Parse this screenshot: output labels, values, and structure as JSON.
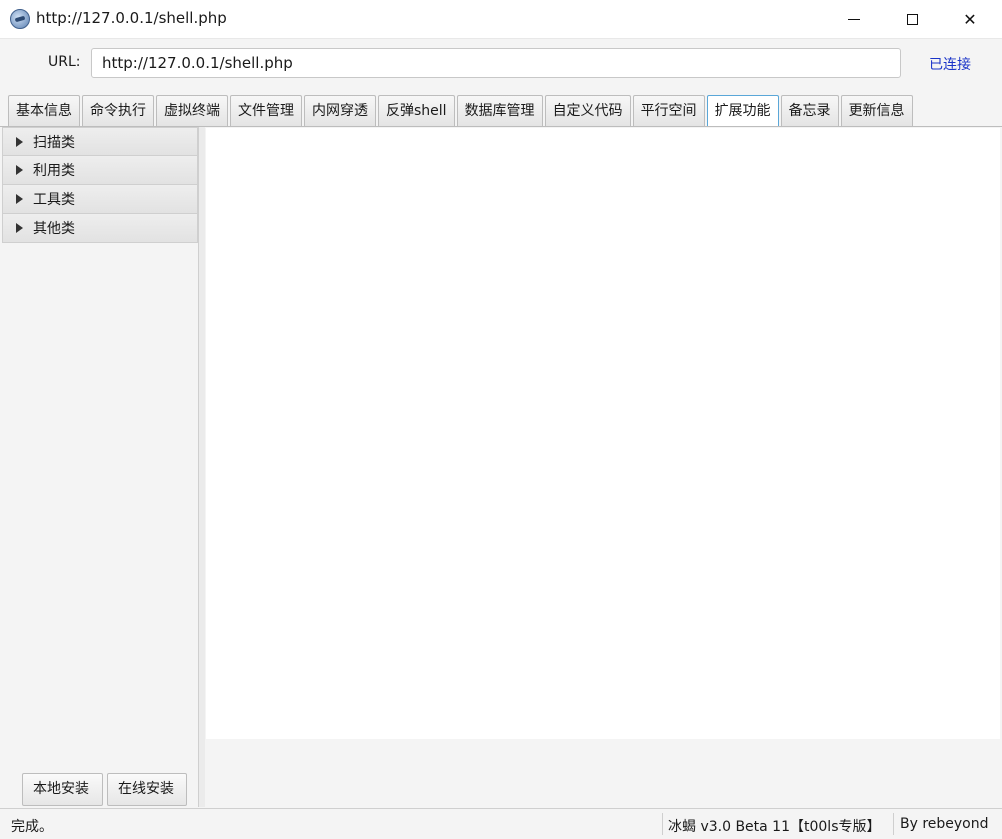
{
  "window": {
    "title": "http://127.0.0.1/shell.php"
  },
  "url_bar": {
    "label": "URL:",
    "value": "http://127.0.0.1/shell.php",
    "status": "已连接",
    "status_color": "#1a33c8"
  },
  "tabs": [
    {
      "label": "基本信息",
      "active": false
    },
    {
      "label": "命令执行",
      "active": false
    },
    {
      "label": "虚拟终端",
      "active": false
    },
    {
      "label": "文件管理",
      "active": false
    },
    {
      "label": "内网穿透",
      "active": false
    },
    {
      "label": "反弹shell",
      "active": false
    },
    {
      "label": "数据库管理",
      "active": false
    },
    {
      "label": "自定义代码",
      "active": false
    },
    {
      "label": "平行空间",
      "active": false
    },
    {
      "label": "扩展功能",
      "active": true
    },
    {
      "label": "备忘录",
      "active": false
    },
    {
      "label": "更新信息",
      "active": false
    }
  ],
  "sidebar": {
    "categories": [
      {
        "label": "扫描类"
      },
      {
        "label": "利用类"
      },
      {
        "label": "工具类"
      },
      {
        "label": "其他类"
      }
    ],
    "buttons": {
      "local_install": "本地安装",
      "online_install": "在线安装"
    }
  },
  "statusbar": {
    "message": "完成。",
    "version": "冰蝎 v3.0 Beta 11【t00ls专版】",
    "author": "By rebeyond"
  }
}
